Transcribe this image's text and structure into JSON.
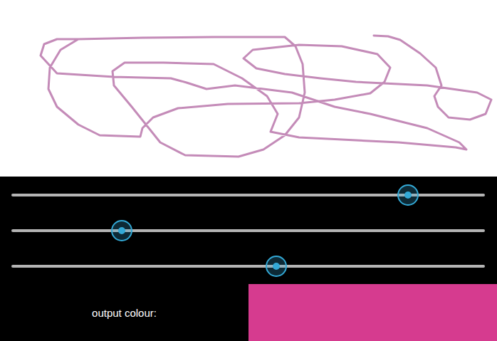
{
  "canvas": {
    "kind": "drawing"
  },
  "sliders": [
    {
      "channel": "red",
      "level": 0.838
    },
    {
      "channel": "green",
      "level": 0.233
    },
    {
      "channel": "blue",
      "level": 0.559
    }
  ],
  "output": {
    "label": "output colour:"
  }
}
